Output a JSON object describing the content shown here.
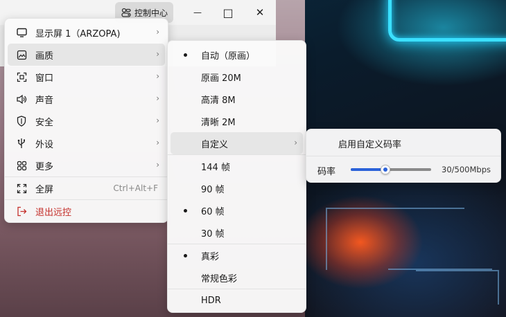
{
  "titlebar": {
    "control_center_label": "控制中心",
    "minimize_glyph": "—",
    "maximize_glyph": "□",
    "close_glyph": "✕"
  },
  "main_menu": {
    "items": [
      {
        "label": "显示屏 1（ARZOPA)",
        "icon": "monitor-icon",
        "has_submenu": true
      },
      {
        "label": "画质",
        "icon": "image-icon",
        "has_submenu": true,
        "highlighted": true
      },
      {
        "label": "窗口",
        "icon": "window-icon",
        "has_submenu": true
      },
      {
        "label": "声音",
        "icon": "speaker-icon",
        "has_submenu": true
      },
      {
        "label": "安全",
        "icon": "shield-icon",
        "has_submenu": true
      },
      {
        "label": "外设",
        "icon": "usb-icon",
        "has_submenu": true
      },
      {
        "label": "更多",
        "icon": "grid-icon",
        "has_submenu": true
      },
      {
        "label": "全屏",
        "icon": "fullscreen-icon",
        "shortcut": "Ctrl+Alt+F"
      },
      {
        "label": "退出远控",
        "icon": "exit-icon",
        "danger": true
      }
    ]
  },
  "quality_menu": {
    "items": [
      {
        "label": "自动（原画）",
        "checked": true
      },
      {
        "label": "原画 20M",
        "checked": false
      },
      {
        "label": "高清 8M",
        "checked": false
      },
      {
        "label": "清晰 2M",
        "checked": false
      },
      {
        "label": "自定义",
        "checked": false,
        "has_submenu": true,
        "highlighted": true
      }
    ],
    "framerates": [
      {
        "label": "144 帧",
        "checked": false
      },
      {
        "label": "90 帧",
        "checked": false
      },
      {
        "label": "60 帧",
        "checked": true
      },
      {
        "label": "30 帧",
        "checked": false
      }
    ],
    "color": [
      {
        "label": "真彩",
        "checked": true
      },
      {
        "label": "常规色彩",
        "checked": false
      }
    ],
    "hdr": {
      "label": "HDR"
    }
  },
  "custom_menu": {
    "enable_label": "启用自定义码率",
    "bitrate_label": "码率",
    "bitrate_value": "30/500Mbps",
    "bitrate_current": 30,
    "bitrate_max": 500,
    "slider_fraction": 0.43
  },
  "colors": {
    "accent": "#2b62d9",
    "danger": "#c4302b",
    "highlight": "#e6e6e6"
  }
}
